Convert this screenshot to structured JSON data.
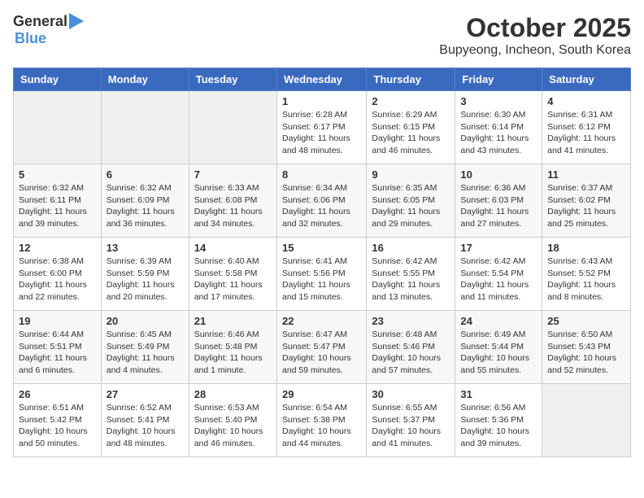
{
  "logo": {
    "general": "General",
    "blue": "Blue"
  },
  "header": {
    "month": "October 2025",
    "location": "Bupyeong, Incheon, South Korea"
  },
  "weekdays": [
    "Sunday",
    "Monday",
    "Tuesday",
    "Wednesday",
    "Thursday",
    "Friday",
    "Saturday"
  ],
  "weeks": [
    [
      {
        "day": "",
        "info": ""
      },
      {
        "day": "",
        "info": ""
      },
      {
        "day": "",
        "info": ""
      },
      {
        "day": "1",
        "info": "Sunrise: 6:28 AM\nSunset: 6:17 PM\nDaylight: 11 hours\nand 48 minutes."
      },
      {
        "day": "2",
        "info": "Sunrise: 6:29 AM\nSunset: 6:15 PM\nDaylight: 11 hours\nand 46 minutes."
      },
      {
        "day": "3",
        "info": "Sunrise: 6:30 AM\nSunset: 6:14 PM\nDaylight: 11 hours\nand 43 minutes."
      },
      {
        "day": "4",
        "info": "Sunrise: 6:31 AM\nSunset: 6:12 PM\nDaylight: 11 hours\nand 41 minutes."
      }
    ],
    [
      {
        "day": "5",
        "info": "Sunrise: 6:32 AM\nSunset: 6:11 PM\nDaylight: 11 hours\nand 39 minutes."
      },
      {
        "day": "6",
        "info": "Sunrise: 6:32 AM\nSunset: 6:09 PM\nDaylight: 11 hours\nand 36 minutes."
      },
      {
        "day": "7",
        "info": "Sunrise: 6:33 AM\nSunset: 6:08 PM\nDaylight: 11 hours\nand 34 minutes."
      },
      {
        "day": "8",
        "info": "Sunrise: 6:34 AM\nSunset: 6:06 PM\nDaylight: 11 hours\nand 32 minutes."
      },
      {
        "day": "9",
        "info": "Sunrise: 6:35 AM\nSunset: 6:05 PM\nDaylight: 11 hours\nand 29 minutes."
      },
      {
        "day": "10",
        "info": "Sunrise: 6:36 AM\nSunset: 6:03 PM\nDaylight: 11 hours\nand 27 minutes."
      },
      {
        "day": "11",
        "info": "Sunrise: 6:37 AM\nSunset: 6:02 PM\nDaylight: 11 hours\nand 25 minutes."
      }
    ],
    [
      {
        "day": "12",
        "info": "Sunrise: 6:38 AM\nSunset: 6:00 PM\nDaylight: 11 hours\nand 22 minutes."
      },
      {
        "day": "13",
        "info": "Sunrise: 6:39 AM\nSunset: 5:59 PM\nDaylight: 11 hours\nand 20 minutes."
      },
      {
        "day": "14",
        "info": "Sunrise: 6:40 AM\nSunset: 5:58 PM\nDaylight: 11 hours\nand 17 minutes."
      },
      {
        "day": "15",
        "info": "Sunrise: 6:41 AM\nSunset: 5:56 PM\nDaylight: 11 hours\nand 15 minutes."
      },
      {
        "day": "16",
        "info": "Sunrise: 6:42 AM\nSunset: 5:55 PM\nDaylight: 11 hours\nand 13 minutes."
      },
      {
        "day": "17",
        "info": "Sunrise: 6:42 AM\nSunset: 5:54 PM\nDaylight: 11 hours\nand 11 minutes."
      },
      {
        "day": "18",
        "info": "Sunrise: 6:43 AM\nSunset: 5:52 PM\nDaylight: 11 hours\nand 8 minutes."
      }
    ],
    [
      {
        "day": "19",
        "info": "Sunrise: 6:44 AM\nSunset: 5:51 PM\nDaylight: 11 hours\nand 6 minutes."
      },
      {
        "day": "20",
        "info": "Sunrise: 6:45 AM\nSunset: 5:49 PM\nDaylight: 11 hours\nand 4 minutes."
      },
      {
        "day": "21",
        "info": "Sunrise: 6:46 AM\nSunset: 5:48 PM\nDaylight: 11 hours\nand 1 minute."
      },
      {
        "day": "22",
        "info": "Sunrise: 6:47 AM\nSunset: 5:47 PM\nDaylight: 10 hours\nand 59 minutes."
      },
      {
        "day": "23",
        "info": "Sunrise: 6:48 AM\nSunset: 5:46 PM\nDaylight: 10 hours\nand 57 minutes."
      },
      {
        "day": "24",
        "info": "Sunrise: 6:49 AM\nSunset: 5:44 PM\nDaylight: 10 hours\nand 55 minutes."
      },
      {
        "day": "25",
        "info": "Sunrise: 6:50 AM\nSunset: 5:43 PM\nDaylight: 10 hours\nand 52 minutes."
      }
    ],
    [
      {
        "day": "26",
        "info": "Sunrise: 6:51 AM\nSunset: 5:42 PM\nDaylight: 10 hours\nand 50 minutes."
      },
      {
        "day": "27",
        "info": "Sunrise: 6:52 AM\nSunset: 5:41 PM\nDaylight: 10 hours\nand 48 minutes."
      },
      {
        "day": "28",
        "info": "Sunrise: 6:53 AM\nSunset: 5:40 PM\nDaylight: 10 hours\nand 46 minutes."
      },
      {
        "day": "29",
        "info": "Sunrise: 6:54 AM\nSunset: 5:38 PM\nDaylight: 10 hours\nand 44 minutes."
      },
      {
        "day": "30",
        "info": "Sunrise: 6:55 AM\nSunset: 5:37 PM\nDaylight: 10 hours\nand 41 minutes."
      },
      {
        "day": "31",
        "info": "Sunrise: 6:56 AM\nSunset: 5:36 PM\nDaylight: 10 hours\nand 39 minutes."
      },
      {
        "day": "",
        "info": ""
      }
    ]
  ]
}
